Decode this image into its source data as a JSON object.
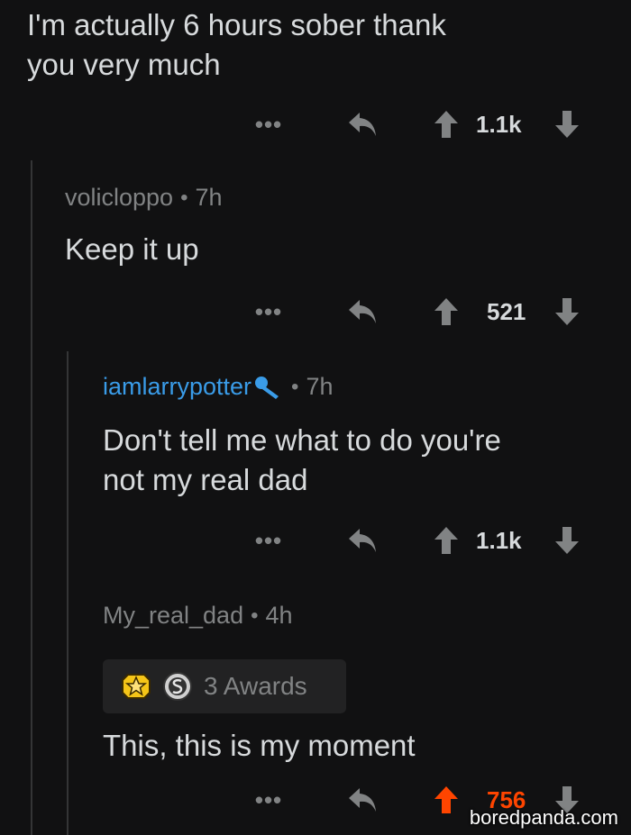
{
  "comments": [
    {
      "text": "I'm actually 6 hours sober thank\nyou very much",
      "score": "1.1k"
    },
    {
      "username": "volicloppo",
      "age": "7h",
      "text": "Keep it up",
      "score": "521"
    },
    {
      "username": "iamlarrypotter",
      "age": "7h",
      "text": "Don't tell me what to do you're\nnot my real dad",
      "score": "1.1k"
    },
    {
      "username": "My_real_dad",
      "age": "4h",
      "awards_label": "3 Awards",
      "text": "This, this is my moment",
      "score": "756"
    }
  ],
  "meta_separator": "•",
  "more_label": "•••",
  "watermark": "boredpanda.com",
  "colors": {
    "background": "#111112",
    "text": "#d7dadc",
    "muted": "#818384",
    "username_highlight": "#3a9ce8",
    "upvoted": "#ff4500"
  },
  "icons": {
    "reply": "reply-arrow-icon",
    "upvote": "upvote-arrow-icon",
    "downvote": "downvote-arrow-icon",
    "more": "more-dots-icon",
    "flair": "microphone-icon",
    "award_1": "gold-star-award-icon",
    "award_2": "silver-s-award-icon"
  }
}
